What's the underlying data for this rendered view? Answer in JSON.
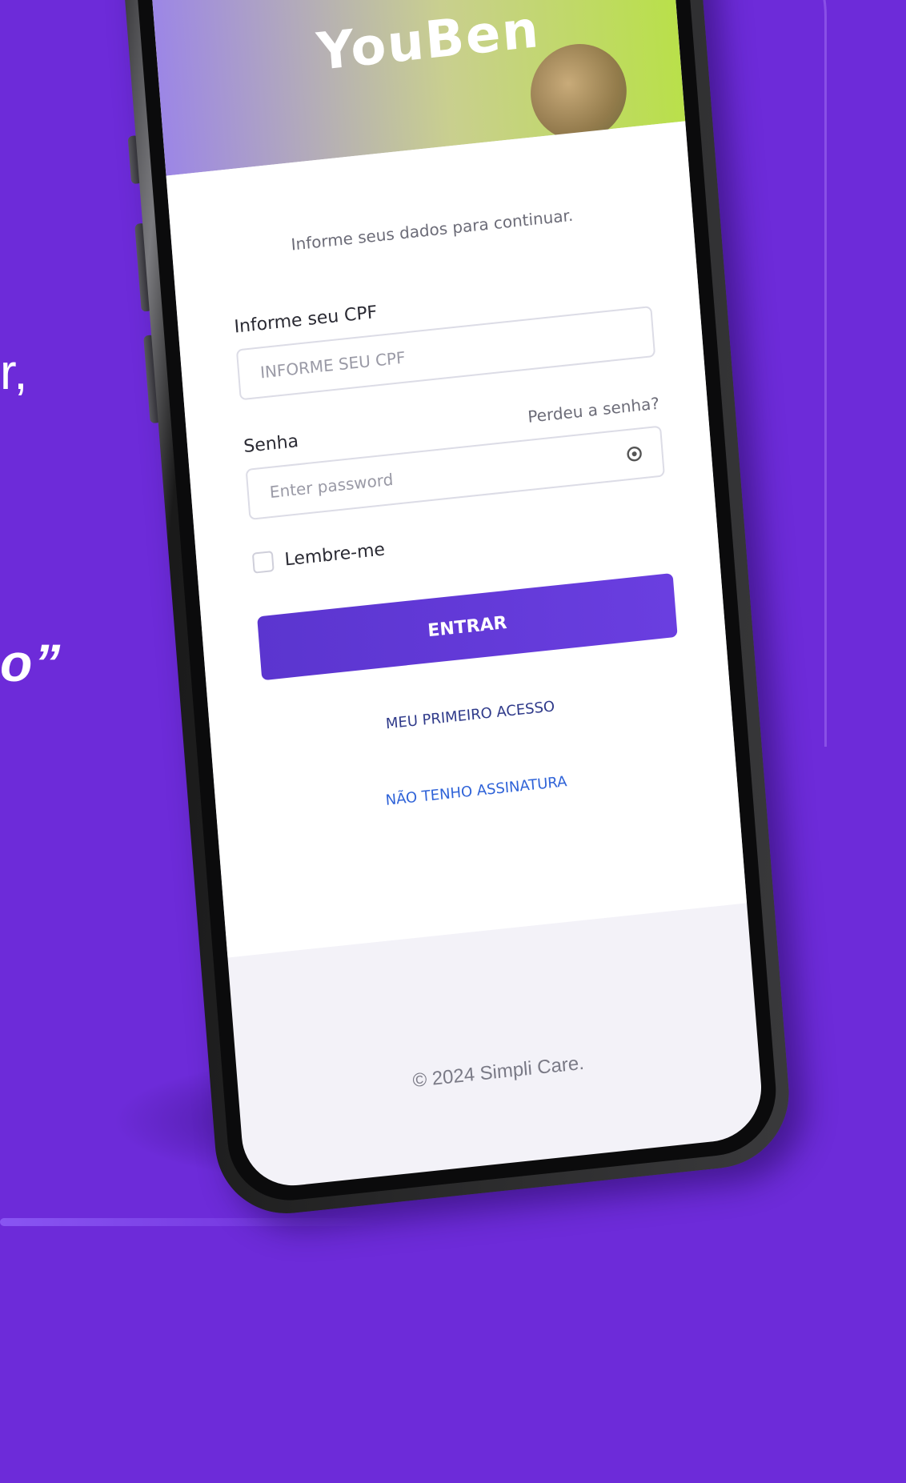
{
  "background": {
    "color": "#6d2bd9",
    "side_text_comma": "r,",
    "side_text_quote": "o”"
  },
  "app": {
    "logo_text": "YouBen",
    "subtitle": "Informe seus dados para continuar.",
    "cpf": {
      "label": "Informe seu CPF",
      "placeholder": "INFORME SEU CPF",
      "value": ""
    },
    "password": {
      "label": "Senha",
      "forgot_link": "Perdeu a senha?",
      "placeholder": "Enter password",
      "value": "",
      "toggle_icon": "eye-icon"
    },
    "remember_label": "Lembre-me",
    "remember_checked": false,
    "submit_label": "ENTRAR",
    "first_access_link": "MEU PRIMEIRO ACESSO",
    "no_subscription_link": "NÃO TENHO ASSINATURA",
    "footer": "© 2024 Simpli Care.",
    "colors": {
      "primary": "#5b35cf",
      "link_blue": "#2f63d8",
      "link_dark": "#2f3a8a"
    }
  }
}
